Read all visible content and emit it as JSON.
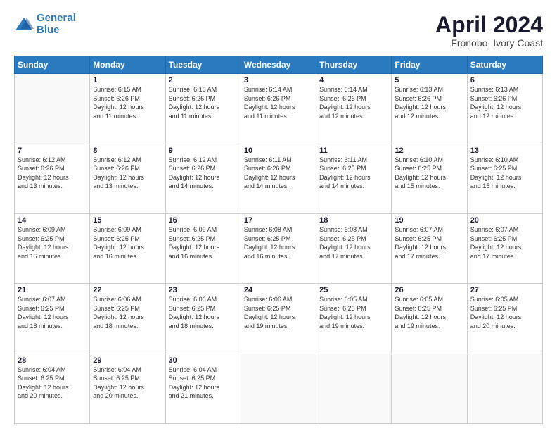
{
  "logo": {
    "line1": "General",
    "line2": "Blue"
  },
  "title": "April 2024",
  "subtitle": "Fronobo, Ivory Coast",
  "weekdays": [
    "Sunday",
    "Monday",
    "Tuesday",
    "Wednesday",
    "Thursday",
    "Friday",
    "Saturday"
  ],
  "weeks": [
    [
      {
        "day": "",
        "info": ""
      },
      {
        "day": "1",
        "info": "Sunrise: 6:15 AM\nSunset: 6:26 PM\nDaylight: 12 hours\nand 11 minutes."
      },
      {
        "day": "2",
        "info": "Sunrise: 6:15 AM\nSunset: 6:26 PM\nDaylight: 12 hours\nand 11 minutes."
      },
      {
        "day": "3",
        "info": "Sunrise: 6:14 AM\nSunset: 6:26 PM\nDaylight: 12 hours\nand 11 minutes."
      },
      {
        "day": "4",
        "info": "Sunrise: 6:14 AM\nSunset: 6:26 PM\nDaylight: 12 hours\nand 12 minutes."
      },
      {
        "day": "5",
        "info": "Sunrise: 6:13 AM\nSunset: 6:26 PM\nDaylight: 12 hours\nand 12 minutes."
      },
      {
        "day": "6",
        "info": "Sunrise: 6:13 AM\nSunset: 6:26 PM\nDaylight: 12 hours\nand 12 minutes."
      }
    ],
    [
      {
        "day": "7",
        "info": "Sunrise: 6:12 AM\nSunset: 6:26 PM\nDaylight: 12 hours\nand 13 minutes."
      },
      {
        "day": "8",
        "info": "Sunrise: 6:12 AM\nSunset: 6:26 PM\nDaylight: 12 hours\nand 13 minutes."
      },
      {
        "day": "9",
        "info": "Sunrise: 6:12 AM\nSunset: 6:26 PM\nDaylight: 12 hours\nand 14 minutes."
      },
      {
        "day": "10",
        "info": "Sunrise: 6:11 AM\nSunset: 6:26 PM\nDaylight: 12 hours\nand 14 minutes."
      },
      {
        "day": "11",
        "info": "Sunrise: 6:11 AM\nSunset: 6:25 PM\nDaylight: 12 hours\nand 14 minutes."
      },
      {
        "day": "12",
        "info": "Sunrise: 6:10 AM\nSunset: 6:25 PM\nDaylight: 12 hours\nand 15 minutes."
      },
      {
        "day": "13",
        "info": "Sunrise: 6:10 AM\nSunset: 6:25 PM\nDaylight: 12 hours\nand 15 minutes."
      }
    ],
    [
      {
        "day": "14",
        "info": "Sunrise: 6:09 AM\nSunset: 6:25 PM\nDaylight: 12 hours\nand 15 minutes."
      },
      {
        "day": "15",
        "info": "Sunrise: 6:09 AM\nSunset: 6:25 PM\nDaylight: 12 hours\nand 16 minutes."
      },
      {
        "day": "16",
        "info": "Sunrise: 6:09 AM\nSunset: 6:25 PM\nDaylight: 12 hours\nand 16 minutes."
      },
      {
        "day": "17",
        "info": "Sunrise: 6:08 AM\nSunset: 6:25 PM\nDaylight: 12 hours\nand 16 minutes."
      },
      {
        "day": "18",
        "info": "Sunrise: 6:08 AM\nSunset: 6:25 PM\nDaylight: 12 hours\nand 17 minutes."
      },
      {
        "day": "19",
        "info": "Sunrise: 6:07 AM\nSunset: 6:25 PM\nDaylight: 12 hours\nand 17 minutes."
      },
      {
        "day": "20",
        "info": "Sunrise: 6:07 AM\nSunset: 6:25 PM\nDaylight: 12 hours\nand 17 minutes."
      }
    ],
    [
      {
        "day": "21",
        "info": "Sunrise: 6:07 AM\nSunset: 6:25 PM\nDaylight: 12 hours\nand 18 minutes."
      },
      {
        "day": "22",
        "info": "Sunrise: 6:06 AM\nSunset: 6:25 PM\nDaylight: 12 hours\nand 18 minutes."
      },
      {
        "day": "23",
        "info": "Sunrise: 6:06 AM\nSunset: 6:25 PM\nDaylight: 12 hours\nand 18 minutes."
      },
      {
        "day": "24",
        "info": "Sunrise: 6:06 AM\nSunset: 6:25 PM\nDaylight: 12 hours\nand 19 minutes."
      },
      {
        "day": "25",
        "info": "Sunrise: 6:05 AM\nSunset: 6:25 PM\nDaylight: 12 hours\nand 19 minutes."
      },
      {
        "day": "26",
        "info": "Sunrise: 6:05 AM\nSunset: 6:25 PM\nDaylight: 12 hours\nand 19 minutes."
      },
      {
        "day": "27",
        "info": "Sunrise: 6:05 AM\nSunset: 6:25 PM\nDaylight: 12 hours\nand 20 minutes."
      }
    ],
    [
      {
        "day": "28",
        "info": "Sunrise: 6:04 AM\nSunset: 6:25 PM\nDaylight: 12 hours\nand 20 minutes."
      },
      {
        "day": "29",
        "info": "Sunrise: 6:04 AM\nSunset: 6:25 PM\nDaylight: 12 hours\nand 20 minutes."
      },
      {
        "day": "30",
        "info": "Sunrise: 6:04 AM\nSunset: 6:25 PM\nDaylight: 12 hours\nand 21 minutes."
      },
      {
        "day": "",
        "info": ""
      },
      {
        "day": "",
        "info": ""
      },
      {
        "day": "",
        "info": ""
      },
      {
        "day": "",
        "info": ""
      }
    ]
  ]
}
